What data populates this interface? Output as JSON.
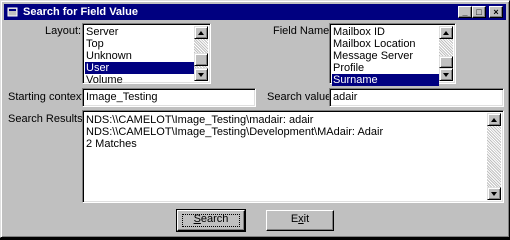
{
  "window": {
    "title": "Search for Field Value",
    "controls": {
      "minimize": "_",
      "maximize": "□",
      "close": "×"
    }
  },
  "layout": {
    "label": "Layout:",
    "items": [
      "Server",
      "Top",
      "Unknown",
      "User",
      "Volume"
    ],
    "selected_index": 3
  },
  "field_name": {
    "label": "Field Name:",
    "items": [
      "Mailbox ID",
      "Mailbox Location",
      "Message Server",
      "Profile",
      "Surname"
    ],
    "selected_index": 4
  },
  "starting_context": {
    "label": "Starting context:",
    "value": "Image_Testing"
  },
  "search_value": {
    "label": "Search value:",
    "value": "adair"
  },
  "search_results": {
    "label": "Search Results:",
    "lines": [
      "NDS:\\\\CAMELOT\\Image_Testing\\madair: adair",
      "NDS:\\\\CAMELOT\\Image_Testing\\Development\\MAdair: Adair",
      "2 Matches"
    ]
  },
  "buttons": {
    "search": {
      "mnemonic": "S",
      "rest": "earch"
    },
    "exit": {
      "pre": "E",
      "mnemonic": "x",
      "rest": "it"
    }
  },
  "colors": {
    "title_bar": "#000080",
    "selection": "#000080",
    "face": "#c0c0c0"
  }
}
